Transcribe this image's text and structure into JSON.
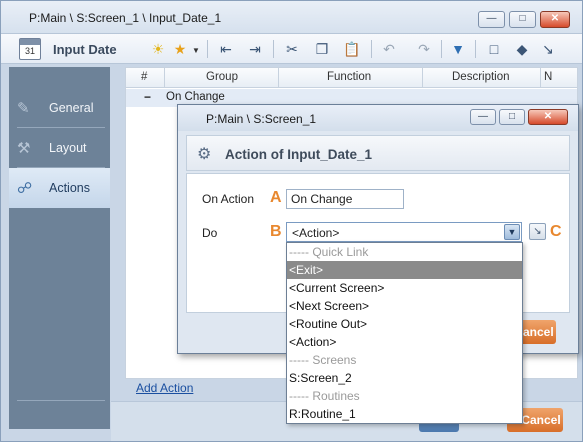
{
  "window": {
    "title": "P:Main \\ S:Screen_1 \\ Input_Date_1"
  },
  "toolbar": {
    "title": "Input Date",
    "calendar_day": "31"
  },
  "nav": {
    "items": [
      {
        "label": "General"
      },
      {
        "label": "Layout"
      },
      {
        "label": "Actions"
      }
    ]
  },
  "grid": {
    "columns": [
      "#",
      "Group",
      "Function",
      "Description",
      "N"
    ],
    "group_row": {
      "toggle": "−",
      "label": "On Change"
    },
    "add_action": "Add Action"
  },
  "outer_buttons": {
    "cancel": "Cancel"
  },
  "dialog": {
    "title": "P:Main \\ S:Screen_1",
    "header": "Action of Input_Date_1",
    "on_action_label": "On Action",
    "on_action_value": "On Change",
    "do_label": "Do",
    "do_value": "<Action>",
    "markers": {
      "a": "A",
      "b": "B",
      "c": "C"
    },
    "cancel": "Cancel"
  },
  "dropdown": {
    "options": [
      {
        "label": "----- Quick Link",
        "kind": "separator"
      },
      {
        "label": "<Exit>",
        "kind": "selected"
      },
      {
        "label": "<Current Screen>",
        "kind": "item"
      },
      {
        "label": "<Next Screen>",
        "kind": "item"
      },
      {
        "label": "<Routine Out>",
        "kind": "item"
      },
      {
        "label": "<Action>",
        "kind": "item"
      },
      {
        "label": "----- Screens",
        "kind": "separator"
      },
      {
        "label": "S:Screen_2",
        "kind": "item"
      },
      {
        "label": "----- Routines",
        "kind": "separator"
      },
      {
        "label": "R:Routine_1",
        "kind": "item"
      }
    ]
  }
}
